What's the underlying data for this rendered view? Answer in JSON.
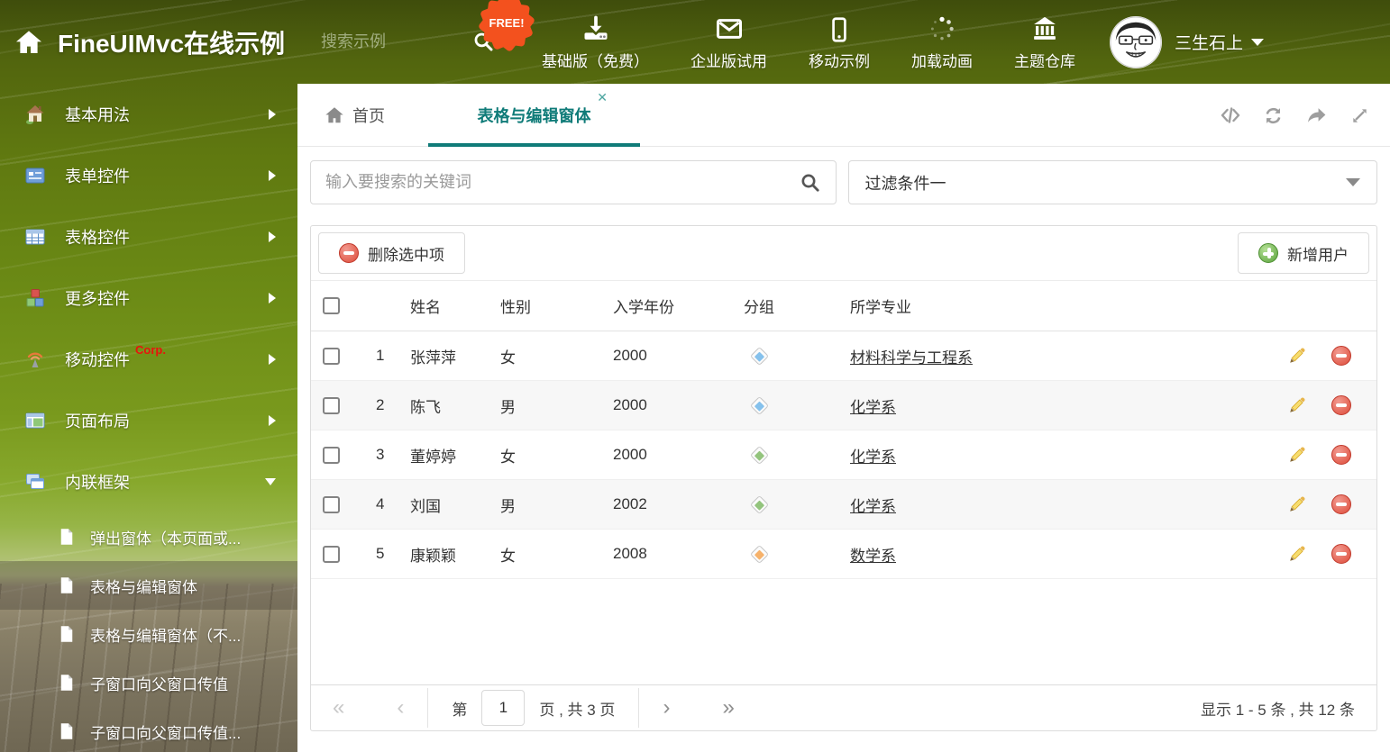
{
  "header": {
    "title": "FineUIMvc在线示例",
    "search_placeholder": "搜索示例",
    "free_badge": "FREE!",
    "nav": [
      {
        "label": "基础版（免费）"
      },
      {
        "label": "企业版试用"
      },
      {
        "label": "移动示例"
      },
      {
        "label": "加载动画"
      },
      {
        "label": "主题仓库"
      }
    ],
    "user_name": "三生石上"
  },
  "sidebar": {
    "items": [
      {
        "label": "基本用法"
      },
      {
        "label": "表单控件"
      },
      {
        "label": "表格控件"
      },
      {
        "label": "更多控件"
      },
      {
        "label": "移动控件",
        "badge": "Corp."
      },
      {
        "label": "页面布局"
      },
      {
        "label": "内联框架"
      }
    ],
    "subitems": [
      {
        "label": "弹出窗体（本页面或..."
      },
      {
        "label": "表格与编辑窗体"
      },
      {
        "label": "表格与编辑窗体（不..."
      },
      {
        "label": "子窗口向父窗口传值"
      },
      {
        "label": "子窗口向父窗口传值..."
      }
    ]
  },
  "tabs": {
    "home": "首页",
    "active": "表格与编辑窗体"
  },
  "filters": {
    "search_placeholder": "输入要搜索的关键词",
    "filter_value": "过滤条件一"
  },
  "toolbar": {
    "delete_label": "删除选中项",
    "add_label": "新增用户"
  },
  "table": {
    "columns": {
      "name": "姓名",
      "gender": "性别",
      "year": "入学年份",
      "group": "分组",
      "major": "所学专业"
    },
    "rows": [
      {
        "num": "1",
        "name": "张萍萍",
        "gender": "女",
        "year": "2000",
        "tag_color": "#85c1ec",
        "major": "材料科学与工程系"
      },
      {
        "num": "2",
        "name": "陈飞",
        "gender": "男",
        "year": "2000",
        "tag_color": "#85c1ec",
        "major": "化学系"
      },
      {
        "num": "3",
        "name": "董婷婷",
        "gender": "女",
        "year": "2000",
        "tag_color": "#93c47d",
        "major": "化学系"
      },
      {
        "num": "4",
        "name": "刘国",
        "gender": "男",
        "year": "2002",
        "tag_color": "#93c47d",
        "major": "化学系"
      },
      {
        "num": "5",
        "name": "康颖颖",
        "gender": "女",
        "year": "2008",
        "tag_color": "#f6b26b",
        "major": "数学系"
      }
    ]
  },
  "pagination": {
    "first": "«",
    "prev": "‹",
    "label_before": "第",
    "current_page": "1",
    "label_after": "页 , 共 3 页",
    "next": "›",
    "last": "»",
    "summary": "显示 1 - 5 条 , 共 12 条"
  },
  "colors": {
    "accent": "#0f7b78",
    "badge_orange": "#f3511e",
    "delete_red": "#dd4b39",
    "add_green": "#5aa33c"
  }
}
